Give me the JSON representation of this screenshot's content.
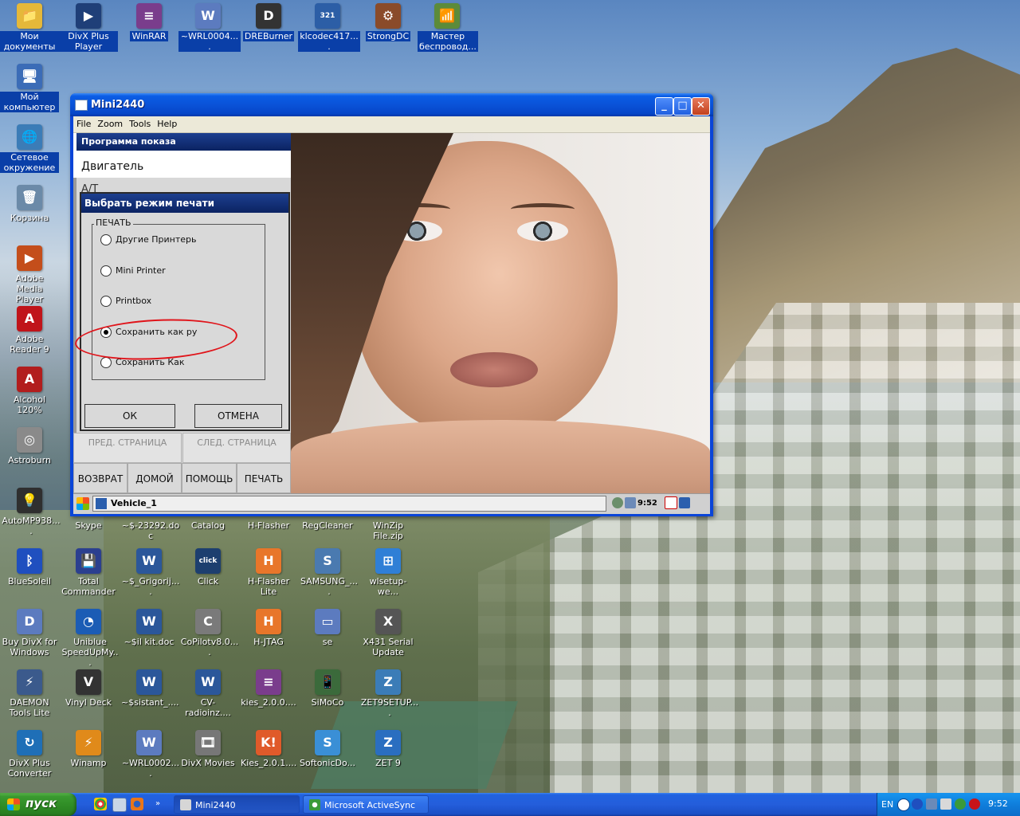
{
  "desktop_icons": [
    {
      "id": "my-documents",
      "label": "Мои документы",
      "glyph": "📁",
      "color": "#e5b83a"
    },
    {
      "id": "divx-plus-player",
      "label": "DivX Plus Player",
      "glyph": "▶",
      "color": "#1f3f78"
    },
    {
      "id": "winrar",
      "label": "WinRAR",
      "glyph": "≡",
      "color": "#7a3d8c"
    },
    {
      "id": "wrl0004",
      "label": "~WRL0004....",
      "glyph": "W",
      "color": "#5c7bbf"
    },
    {
      "id": "dreburner",
      "label": "DREBurner",
      "glyph": "D",
      "color": "#333"
    },
    {
      "id": "klcodec",
      "label": "klcodec417....",
      "glyph": "321",
      "color": "#2c5ea6"
    },
    {
      "id": "strongdc",
      "label": "StrongDC",
      "glyph": "⚙",
      "color": "#8a4b2a"
    },
    {
      "id": "master-wireless",
      "label": "Мастер беспровод...",
      "glyph": "📶",
      "color": "#5c8b3a"
    },
    {
      "id": "my-computer",
      "label": "Мой компьютер",
      "glyph": "🖥",
      "color": "#3b6cb7"
    },
    {
      "id": "network",
      "label": "Сетевое окружение",
      "glyph": "🌐",
      "color": "#3b7cb7"
    },
    {
      "id": "recycle-bin",
      "label": "Корзина",
      "glyph": "🗑",
      "color": "#6b8aa8"
    },
    {
      "id": "adobe-media-player",
      "label": "Adobe Media Player",
      "glyph": "▶",
      "color": "#c44e1b"
    },
    {
      "id": "adobe-reader",
      "label": "Adobe Reader 9",
      "glyph": "A",
      "color": "#c0141a"
    },
    {
      "id": "alcohol",
      "label": "Alcohol 120%",
      "glyph": "A",
      "color": "#b21d1d"
    },
    {
      "id": "astroburn",
      "label": "Astroburn",
      "glyph": "◎",
      "color": "#8a8a8a"
    },
    {
      "id": "automp",
      "label": "AutoMP938....",
      "glyph": "💡",
      "color": "#2f2f2f"
    },
    {
      "id": "skype",
      "label": "Skype",
      "glyph": "S",
      "color": "#00aff0"
    },
    {
      "id": "doc23292",
      "label": "~$-23292.doc",
      "glyph": "W",
      "color": "#2b579a"
    },
    {
      "id": "catalog",
      "label": "Catalog",
      "glyph": "C",
      "color": "#777"
    },
    {
      "id": "h-flasher",
      "label": "H-Flasher",
      "glyph": "H",
      "color": "#d46b1f"
    },
    {
      "id": "regcleaner",
      "label": "RegCleaner",
      "glyph": "R",
      "color": "#3c6ea8"
    },
    {
      "id": "winzip",
      "label": "WinZip File.zip",
      "glyph": "Z",
      "color": "#c8a21a"
    },
    {
      "id": "bluesoleil",
      "label": "BlueSoleil",
      "glyph": "ᛒ",
      "color": "#1f4fbf"
    },
    {
      "id": "total-commander",
      "label": "Total Commander",
      "glyph": "💾",
      "color": "#2b3f8f"
    },
    {
      "id": "grigorij",
      "label": "~$_Grigorij....",
      "glyph": "W",
      "color": "#2b579a"
    },
    {
      "id": "click",
      "label": "Click",
      "glyph": "click",
      "color": "#1d3f6f"
    },
    {
      "id": "h-flasher-lite",
      "label": "H-Flasher Lite",
      "glyph": "H",
      "color": "#e8762a"
    },
    {
      "id": "samsung",
      "label": "SAMSUNG_....",
      "glyph": "S",
      "color": "#4a7ab0"
    },
    {
      "id": "wlsetup",
      "label": "wlsetup-we...",
      "glyph": "⊞",
      "color": "#2f7fd6"
    },
    {
      "id": "buy-divx",
      "label": "Buy DivX for Windows",
      "glyph": "D",
      "color": "#5c7bbf"
    },
    {
      "id": "uniblue",
      "label": "Uniblue SpeedUpMy...",
      "glyph": "◔",
      "color": "#1b5cb5"
    },
    {
      "id": "kit-doc",
      "label": "~$il kit.doc",
      "glyph": "W",
      "color": "#2b579a"
    },
    {
      "id": "copilot",
      "label": "CoPilotv8.0....",
      "glyph": "C",
      "color": "#7a7a7a"
    },
    {
      "id": "h-jtag",
      "label": "H-JTAG",
      "glyph": "H",
      "color": "#e8762a"
    },
    {
      "id": "se",
      "label": "se",
      "glyph": "▭",
      "color": "#5c7bbf"
    },
    {
      "id": "x431",
      "label": "X431 Serial Update",
      "glyph": "X",
      "color": "#555"
    },
    {
      "id": "daemon-tools",
      "label": "DAEMON Tools Lite",
      "glyph": "⚡",
      "color": "#3b5a8c"
    },
    {
      "id": "vinyl-deck",
      "label": "Vinyl Deck",
      "glyph": "V",
      "color": "#333"
    },
    {
      "id": "sistant",
      "label": "~$sistant_....",
      "glyph": "W",
      "color": "#2b579a"
    },
    {
      "id": "cv-radio",
      "label": "CV-radioinz....",
      "glyph": "W",
      "color": "#2b579a"
    },
    {
      "id": "kies200",
      "label": "kies_2.0.0....",
      "glyph": "≡",
      "color": "#7a3d8c"
    },
    {
      "id": "simoco",
      "label": "SiMoCo",
      "glyph": "📱",
      "color": "#3b6a3b"
    },
    {
      "id": "zet9setup",
      "label": "ZET9SETUP....",
      "glyph": "Z",
      "color": "#3b7cb7"
    },
    {
      "id": "divx-converter",
      "label": "DivX Plus Converter",
      "glyph": "↻",
      "color": "#1f6fb7"
    },
    {
      "id": "winamp",
      "label": "Winamp",
      "glyph": "⚡",
      "color": "#e08a1a"
    },
    {
      "id": "wrl0002",
      "label": "~WRL0002....",
      "glyph": "W",
      "color": "#5c7bbf"
    },
    {
      "id": "divx-movies",
      "label": "DivX Movies",
      "glyph": "🎞",
      "color": "#777"
    },
    {
      "id": "kies201",
      "label": "Kies_2.0.1....",
      "glyph": "K!",
      "color": "#e05a2a"
    },
    {
      "id": "softonic",
      "label": "SoftonicDo...",
      "glyph": "S",
      "color": "#3a8fd6"
    },
    {
      "id": "zet9",
      "label": "ZET 9",
      "glyph": "Z",
      "color": "#2a6ec0"
    }
  ],
  "window": {
    "title": "Mini2440",
    "minimize_glyph": "_",
    "maximize_glyph": "□",
    "close_glyph": "✕",
    "menu": [
      "File",
      "Zoom",
      "Tools",
      "Help"
    ]
  },
  "device": {
    "panel_header": "Программа показа",
    "panel_item": "Двигатель",
    "panel_item_partial": "А/Т",
    "prev_page": "ПРЕД. СТРАНИЦА",
    "next_page": "СЛЕД. СТРАНИЦА",
    "actions": [
      "ВОЗВРАТ",
      "ДОМОЙ",
      "ПОМОЩЬ",
      "ПЕЧАТЬ"
    ],
    "dialog": {
      "title": "Выбрать режим печати",
      "group_label": "ПЕЧАТЬ",
      "options": [
        {
          "label": "Другие Принтерь",
          "selected": false
        },
        {
          "label": "Mini Printer",
          "selected": false
        },
        {
          "label": "Printbox",
          "selected": false
        },
        {
          "label": "Сохранить как ру",
          "selected": true
        },
        {
          "label": "Сохранить Как",
          "selected": false
        }
      ],
      "ok": "ОК",
      "cancel": "ОТМЕНА"
    },
    "taskbar": {
      "task": "Vehicle_1",
      "time": "9:52"
    }
  },
  "taskbar": {
    "start": "пуск",
    "items": [
      {
        "label": "Mini2440",
        "active": true
      },
      {
        "label": "Microsoft ActiveSync",
        "active": false
      }
    ],
    "lang": "EN",
    "time": "9:52"
  }
}
